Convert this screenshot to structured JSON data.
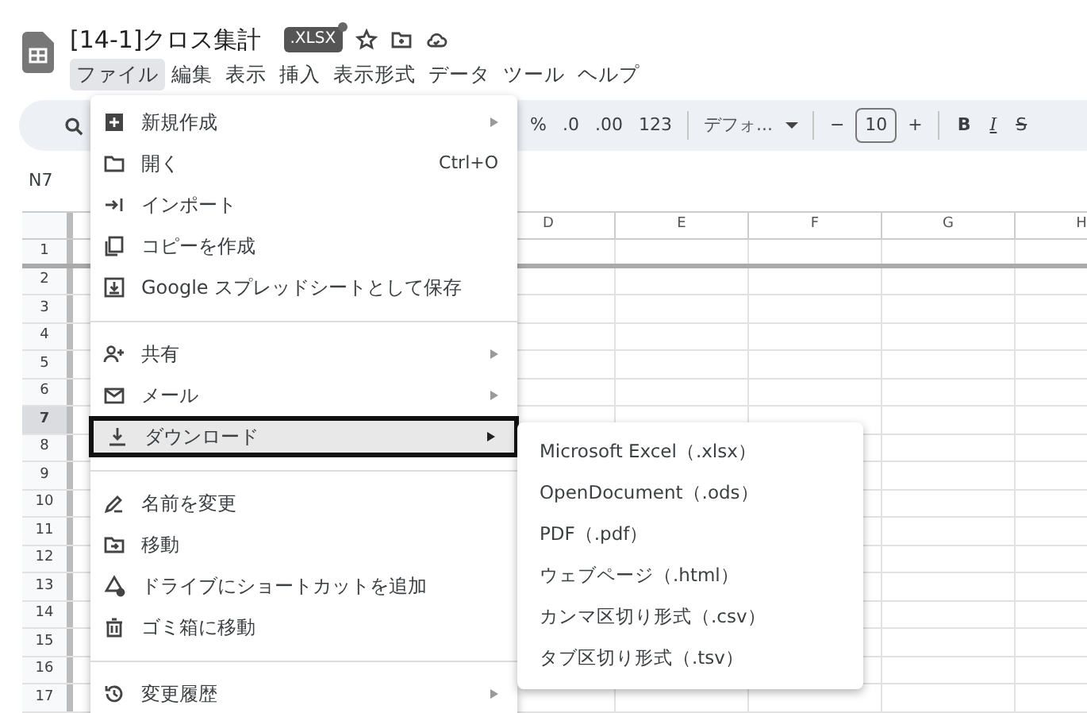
{
  "document": {
    "title": "[14-1]クロス集計",
    "badge": ".XLSX"
  },
  "menubar": [
    {
      "label": "ファイル",
      "selected": true
    },
    {
      "label": "編集",
      "selected": false
    },
    {
      "label": "表示",
      "selected": false
    },
    {
      "label": "挿入",
      "selected": false
    },
    {
      "label": "表示形式",
      "selected": false
    },
    {
      "label": "データ",
      "selected": false
    },
    {
      "label": "ツール",
      "selected": false
    },
    {
      "label": "ヘルプ",
      "selected": false
    }
  ],
  "toolbar": [
    {
      "kind": "text",
      "label": "%"
    },
    {
      "kind": "text",
      "label": ".0"
    },
    {
      "kind": "text",
      "label": ".00"
    },
    {
      "kind": "text",
      "label": "123"
    },
    {
      "kind": "sep"
    },
    {
      "kind": "dropdown",
      "label": "デフォ..."
    },
    {
      "kind": "sep"
    },
    {
      "kind": "text",
      "label": "−"
    },
    {
      "kind": "field",
      "label": "10"
    },
    {
      "kind": "text",
      "label": "+"
    },
    {
      "kind": "sep"
    },
    {
      "kind": "bold",
      "label": "B"
    },
    {
      "kind": "italic",
      "label": "I"
    },
    {
      "kind": "strike",
      "label": "S"
    }
  ],
  "name_box": "N7",
  "columns": [
    "D",
    "E",
    "F",
    "G",
    "H"
  ],
  "rows": [
    {
      "label": "1",
      "selected": false
    },
    {
      "label": "2",
      "selected": false
    },
    {
      "label": "3",
      "selected": false
    },
    {
      "label": "4",
      "selected": false
    },
    {
      "label": "5",
      "selected": false
    },
    {
      "label": "6",
      "selected": false
    },
    {
      "label": "7",
      "selected": true
    },
    {
      "label": "8",
      "selected": false
    },
    {
      "label": "9",
      "selected": false
    },
    {
      "label": "10",
      "selected": false
    },
    {
      "label": "11",
      "selected": false
    },
    {
      "label": "12",
      "selected": false
    },
    {
      "label": "13",
      "selected": false
    },
    {
      "label": "14",
      "selected": false
    },
    {
      "label": "15",
      "selected": false
    },
    {
      "label": "16",
      "selected": false
    },
    {
      "label": "17",
      "selected": false
    }
  ],
  "file_menu": [
    {
      "kind": "item",
      "label": "新規作成",
      "submenu": true,
      "selected": false
    },
    {
      "kind": "item",
      "label": "開く",
      "shortcut": "Ctrl+O",
      "submenu": false,
      "selected": false
    },
    {
      "kind": "item",
      "label": "インポート",
      "submenu": false,
      "selected": false
    },
    {
      "kind": "item",
      "label": "コピーを作成",
      "submenu": false,
      "selected": false
    },
    {
      "kind": "item",
      "label": "Google スプレッドシートとして保存",
      "submenu": false,
      "selected": false
    },
    {
      "kind": "divider"
    },
    {
      "kind": "item",
      "label": "共有",
      "submenu": true,
      "selected": false
    },
    {
      "kind": "item",
      "label": "メール",
      "submenu": true,
      "selected": false
    },
    {
      "kind": "item",
      "label": "ダウンロード",
      "submenu": true,
      "selected": true
    },
    {
      "kind": "divider"
    },
    {
      "kind": "item",
      "label": "名前を変更",
      "submenu": false,
      "selected": false
    },
    {
      "kind": "item",
      "label": "移動",
      "submenu": false,
      "selected": false
    },
    {
      "kind": "item",
      "label": "ドライブにショートカットを追加",
      "submenu": false,
      "selected": false
    },
    {
      "kind": "item",
      "label": "ゴミ箱に移動",
      "submenu": false,
      "selected": false
    },
    {
      "kind": "divider"
    },
    {
      "kind": "item",
      "label": "変更履歴",
      "submenu": true,
      "selected": false
    }
  ],
  "download_menu": [
    "Microsoft Excel（.xlsx）",
    "OpenDocument（.ods）",
    "PDF（.pdf）",
    "ウェブページ（.html）",
    "カンマ区切り形式（.csv）",
    "タブ区切り形式（.tsv）"
  ]
}
